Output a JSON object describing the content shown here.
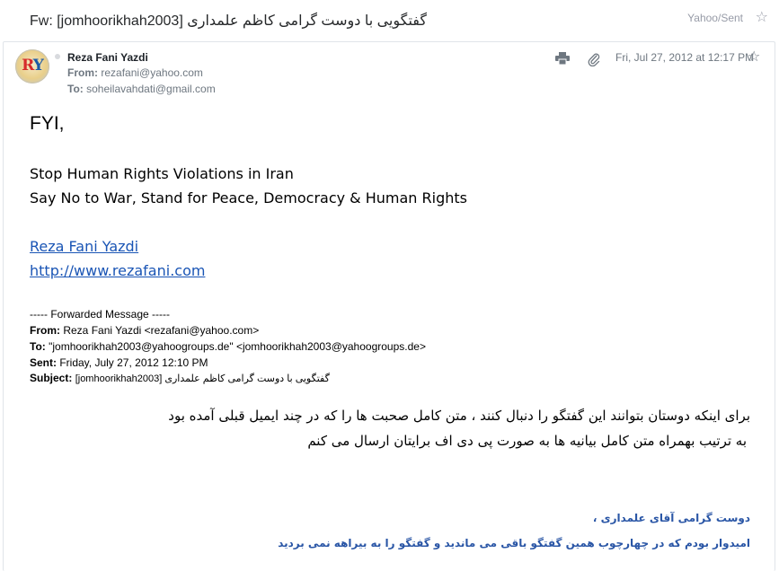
{
  "subject": "Fw: [jomhoorikhah2003] گفتگویی با دوست گرامی کاظم علمداری",
  "folder": "Yahoo/Sent",
  "sender": {
    "avatar_text_r": "R",
    "avatar_text_y": "Y",
    "name": "Reza Fani Yazdi",
    "from_label": "From:",
    "from_email": "rezafani@yahoo.com",
    "to_label": "To:",
    "to_email": "soheilavahdati@gmail.com"
  },
  "date": "Fri, Jul 27, 2012 at 12:17 PM",
  "body": {
    "greeting": "FYI,",
    "signature_line1": "Stop Human Rights Violations in Iran",
    "signature_line2": "Say No to War, Stand for Peace, Democracy & Human Rights",
    "link_name": "Reza Fani Yazdi",
    "link_url": "http://www.rezafani.com",
    "forwarded": {
      "title": "----- Forwarded Message -----",
      "from_label": "From:",
      "from_value": "Reza Fani Yazdi <rezafani@yahoo.com>",
      "to_label": "To:",
      "to_value": "\"jomhoorikhah2003@yahoogroups.de\" <jomhoorikhah2003@yahoogroups.de>",
      "sent_label": "Sent:",
      "sent_value": "Friday, July 27, 2012 12:10 PM",
      "subject_label": "Subject:",
      "subject_value": "[jomhoorikhah2003] گفتگویی با دوست گرامی کاظم علمداری"
    },
    "persian_line1": "برای اینکه دوستان بتوانند این گفتگو را دنبال کنند ، متن کامل صحبت ها را که در چند ایمیل قبلی آمده بود",
    "persian_line2": "به ترتیب بهمراه متن کامل بیانیه ها به صورت پی دی اف برایتان ارسال می کنم",
    "quoted_line1": "دوست گرامی آقای علمداری ،",
    "quoted_line2": "امیدوار بودم که در چهارچوب همین گفتگو باقی می ماندید و گفتگو را به بیراهه نمی بردید"
  },
  "colors": {
    "link": "#1a55b5",
    "quoted_text": "#2a56a6",
    "meta_text": "#6e7780"
  },
  "icons": [
    "star-icon",
    "print-icon",
    "paperclip-icon",
    "star-icon"
  ]
}
